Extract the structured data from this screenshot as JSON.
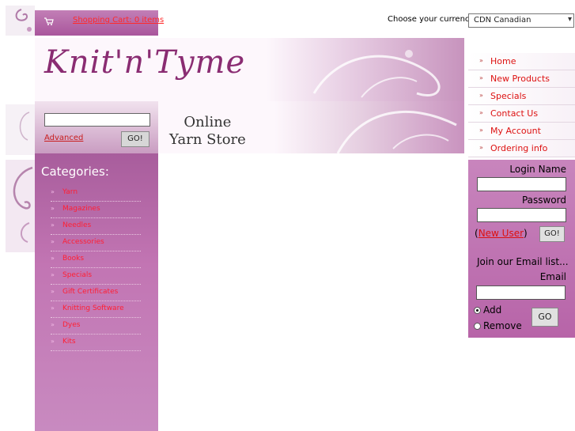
{
  "header": {
    "cart_link": "Shopping Cart: 0 items",
    "currency_label": "Choose your currency:",
    "currency_selected": "CDN Canadian",
    "logo_text": "Knit'n'Tyme",
    "online_line1": "Online",
    "online_line2": "Yarn Store"
  },
  "search": {
    "value": "",
    "advanced_label": "Advanced",
    "go_label": "GO!"
  },
  "categories": {
    "title": "Categories:",
    "items": [
      {
        "label": "Yarn"
      },
      {
        "label": "Magazines"
      },
      {
        "label": "Needles"
      },
      {
        "label": "Accessories"
      },
      {
        "label": "Books"
      },
      {
        "label": "Specials"
      },
      {
        "label": "Gift Certificates"
      },
      {
        "label": "Knitting Software"
      },
      {
        "label": "Dyes"
      },
      {
        "label": "Kits"
      }
    ]
  },
  "nav": {
    "items": [
      {
        "label": "Home"
      },
      {
        "label": "New Products"
      },
      {
        "label": "Specials"
      },
      {
        "label": "Contact Us"
      },
      {
        "label": "My Account"
      },
      {
        "label": "Ordering info"
      }
    ]
  },
  "login": {
    "name_label": "Login Name",
    "password_label": "Password",
    "new_user_label": "New User",
    "go_label": "GO!"
  },
  "newsletter": {
    "join_label": "Join our Email list...",
    "email_label": "Email",
    "add_label": "Add",
    "remove_label": "Remove",
    "go_label": "GO"
  },
  "colors": {
    "accent_purple": "#b764a8",
    "link_red": "#dd1111",
    "logo_purple": "#8a2c72"
  }
}
